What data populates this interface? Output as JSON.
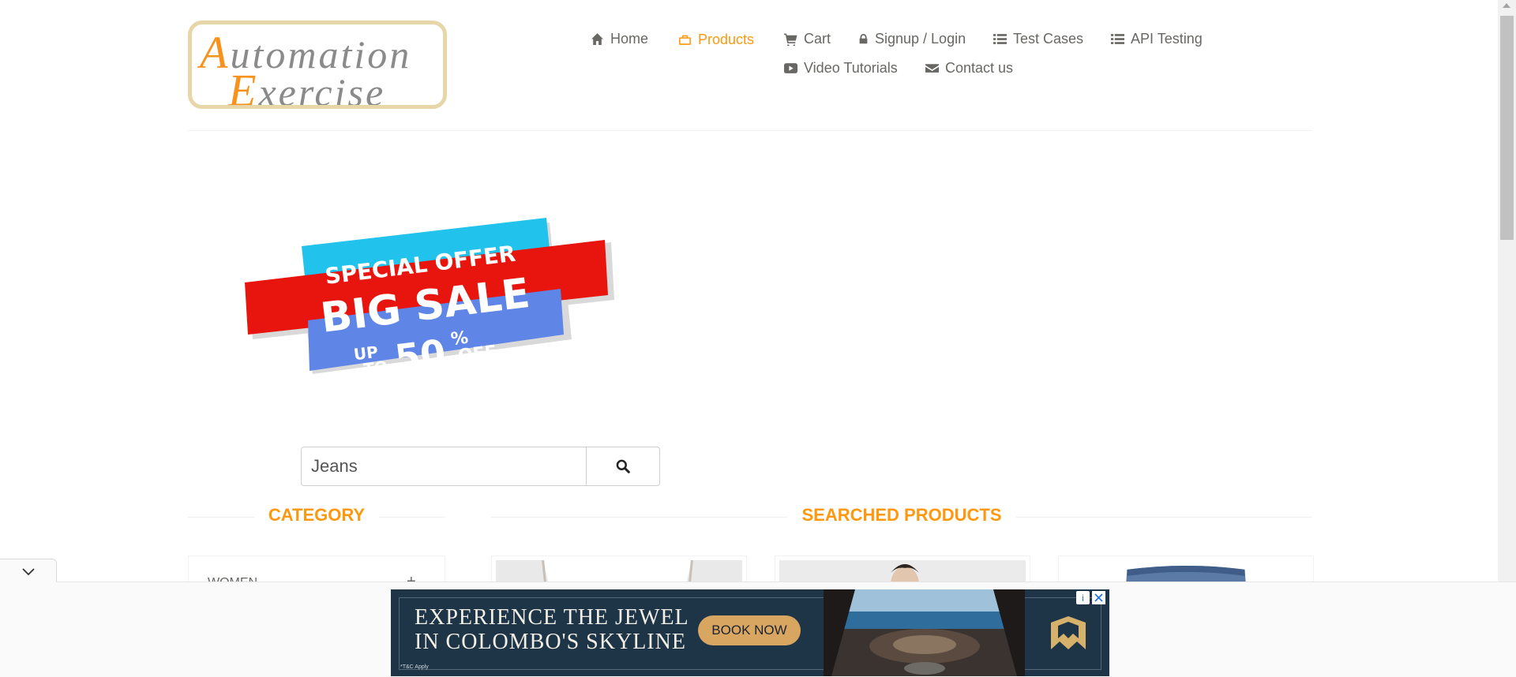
{
  "logo": {
    "line1_cap": "A",
    "line1_rest": "utomation",
    "line2_cap": "E",
    "line2_rest": "xercise"
  },
  "nav": {
    "home": {
      "label": "Home",
      "icon": "home-icon"
    },
    "products": {
      "label": "Products",
      "icon": "briefcase-icon",
      "active": true
    },
    "cart": {
      "label": "Cart",
      "icon": "shopping-cart-icon"
    },
    "signup": {
      "label": "Signup / Login",
      "icon": "lock-icon"
    },
    "test_cases": {
      "label": "Test Cases",
      "icon": "list-icon"
    },
    "api_testing": {
      "label": "API Testing",
      "icon": "list-icon"
    },
    "video_tutorials": {
      "label": "Video Tutorials",
      "icon": "youtube-play-icon"
    },
    "contact": {
      "label": "Contact us",
      "icon": "envelope-icon"
    }
  },
  "banner": {
    "line1": "SPECIAL OFFER",
    "line2": "BIG SALE",
    "up_to_1": "UP",
    "up_to_2": "TO",
    "percent": "50",
    "percent_sign": "%",
    "off": "OFF"
  },
  "search": {
    "value": "Jeans",
    "icon": "search-icon"
  },
  "category": {
    "title": "Category",
    "items": [
      {
        "label": "Women",
        "toggle": "+"
      }
    ]
  },
  "products": {
    "title": "Searched Products"
  },
  "ad": {
    "headline_1": "EXPERIENCE THE JEWEL",
    "headline_2": "IN COLOMBO'S SKYLINE",
    "cta": "BOOK NOW",
    "disclaimer": "*T&C Apply",
    "info_icon": "info-icon",
    "close_icon": "close-icon"
  },
  "colors": {
    "accent": "#fe980f",
    "nav_text": "#696763",
    "ad_bg": "#1e3548",
    "ad_button": "#d9a662"
  }
}
